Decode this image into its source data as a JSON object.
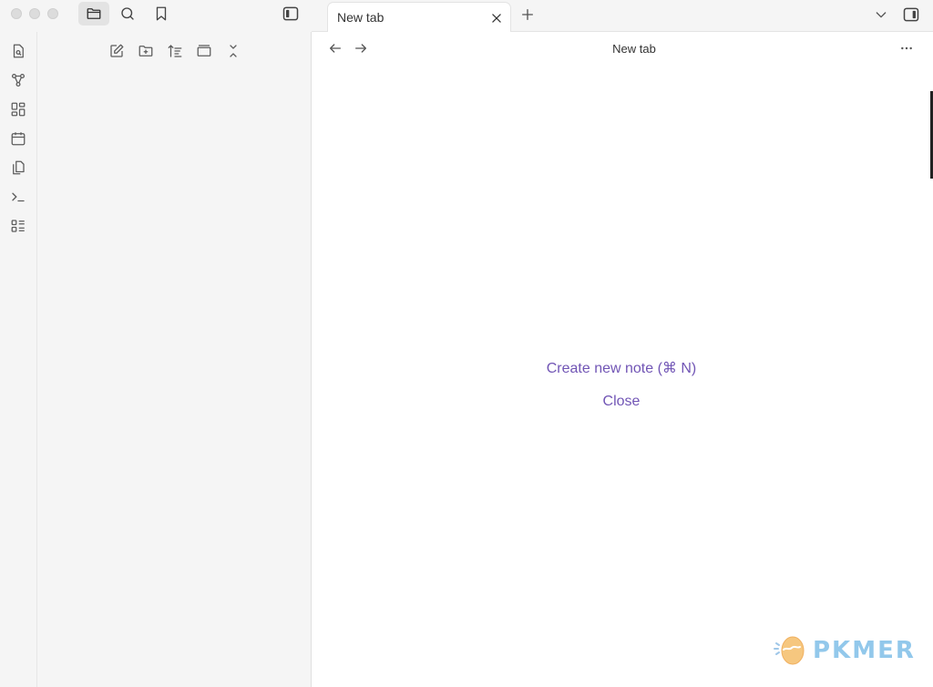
{
  "window": {
    "traffic_lights": [
      "close",
      "minimize",
      "maximize"
    ]
  },
  "left_titlebar": {
    "buttons": [
      {
        "icon": "folder-icon",
        "tooltip": "Files",
        "active": true
      },
      {
        "icon": "search-icon",
        "tooltip": "Search"
      },
      {
        "icon": "bookmark-icon",
        "tooltip": "Bookmarks"
      },
      {
        "icon": "sidebar-toggle-icon",
        "tooltip": "Collapse"
      }
    ]
  },
  "ribbon": {
    "items": [
      {
        "icon": "quick-switcher-icon"
      },
      {
        "icon": "graph-icon"
      },
      {
        "icon": "canvas-icon"
      },
      {
        "icon": "calendar-icon"
      },
      {
        "icon": "templates-icon"
      },
      {
        "icon": "command-palette-icon"
      },
      {
        "icon": "outline-icon"
      }
    ]
  },
  "explorer": {
    "nav_buttons": [
      {
        "icon": "new-note-icon"
      },
      {
        "icon": "new-folder-icon"
      },
      {
        "icon": "sort-icon"
      },
      {
        "icon": "auto-reveal-icon"
      },
      {
        "icon": "collapse-all-icon"
      }
    ]
  },
  "tabs": {
    "active_title": "New tab"
  },
  "view": {
    "title": "New tab"
  },
  "empty_state": {
    "create_label": "Create new note (⌘ N)",
    "close_label": "Close"
  },
  "watermark": {
    "text": "PKMER"
  },
  "colors": {
    "accent": "#7155b5",
    "sidebar_bg": "#f5f5f5",
    "icon": "#5c5c5c"
  }
}
